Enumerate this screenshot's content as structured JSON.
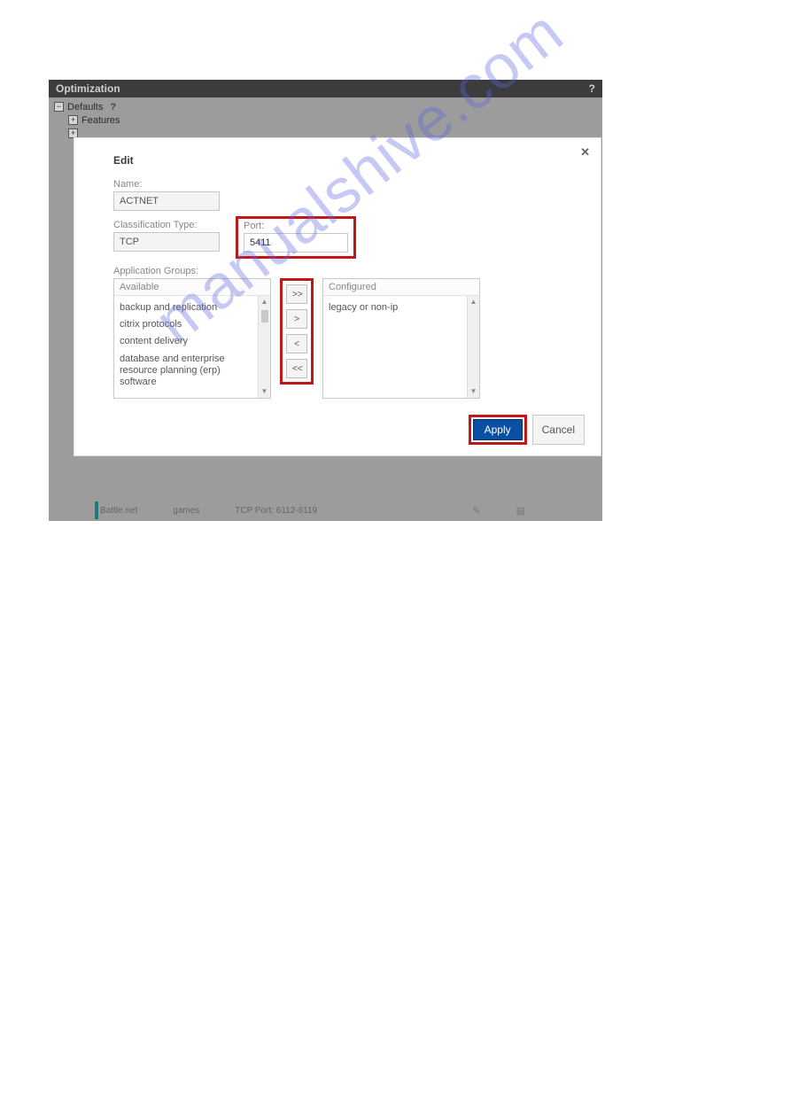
{
  "header": {
    "title": "Optimization"
  },
  "tree": {
    "root": "Defaults",
    "child": "Features"
  },
  "dialog": {
    "title": "Edit",
    "name": {
      "label": "Name:",
      "value": "ACTNET"
    },
    "classification": {
      "label": "Classification Type:",
      "value": "TCP"
    },
    "port": {
      "label": "Port:",
      "value": "5411"
    },
    "groups_label": "Application Groups:",
    "available": {
      "header": "Available",
      "items": [
        "backup and replication",
        "citrix protocols",
        "content delivery",
        "database and enterprise resource planning (erp) software"
      ]
    },
    "configured": {
      "header": "Configured",
      "items": [
        "legacy or non-ip"
      ]
    },
    "buttons": {
      "move_all_right": ">>",
      "move_right": ">",
      "move_left": "<",
      "move_all_left": "<<",
      "apply": "Apply",
      "cancel": "Cancel"
    }
  },
  "bg_row": {
    "col1": "Battle.net",
    "col2": "games",
    "col3": "TCP Port: 6112-6119"
  },
  "watermark": "manualshive.com"
}
